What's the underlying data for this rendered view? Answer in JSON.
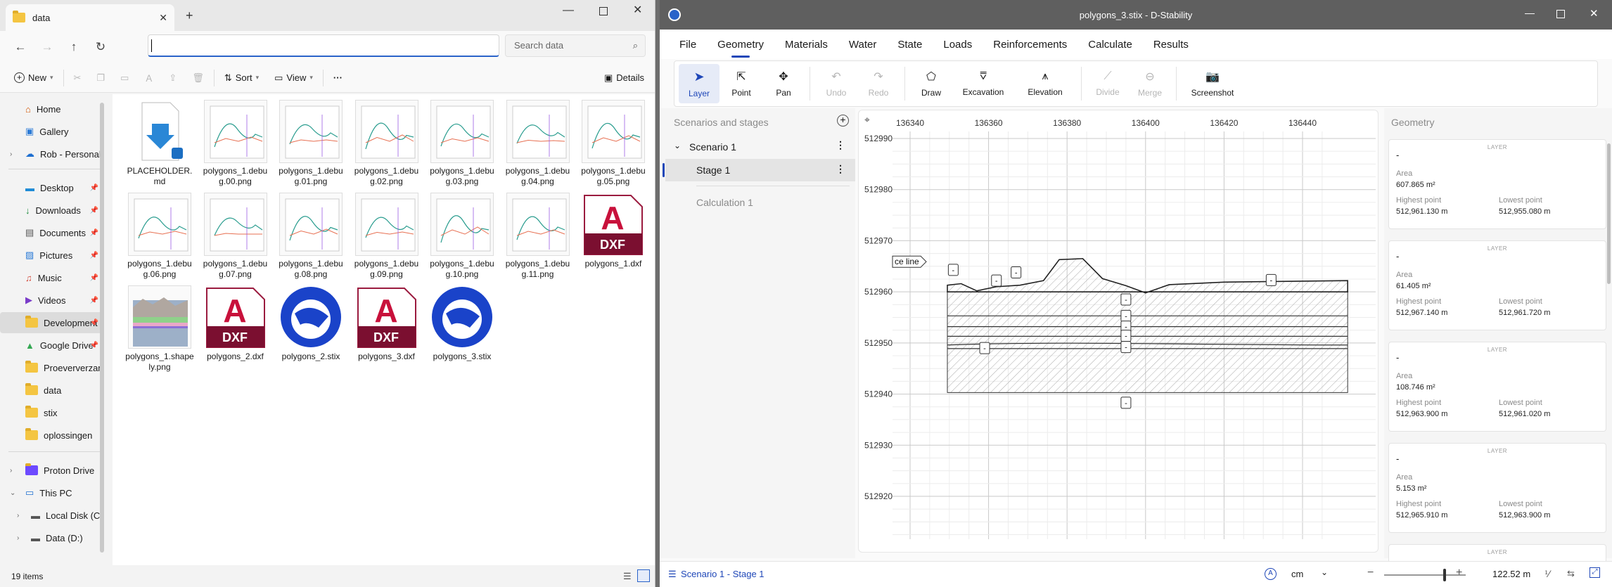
{
  "explorer": {
    "tab_title": "data",
    "search_placeholder": "Search data",
    "toolbar": {
      "new": "New",
      "sort": "Sort",
      "view": "View",
      "details": "Details"
    },
    "nav": [
      {
        "label": "Home"
      },
      {
        "label": "Gallery"
      },
      {
        "label": "Rob - Personal"
      },
      {
        "label": "Desktop"
      },
      {
        "label": "Downloads"
      },
      {
        "label": "Documents"
      },
      {
        "label": "Pictures"
      },
      {
        "label": "Music"
      },
      {
        "label": "Videos"
      },
      {
        "label": "Development"
      },
      {
        "label": "Google Drive"
      },
      {
        "label": "Proeververzameling"
      },
      {
        "label": "data"
      },
      {
        "label": "stix"
      },
      {
        "label": "oplossingen"
      },
      {
        "label": "Proton Drive"
      },
      {
        "label": "This PC"
      },
      {
        "label": "Local Disk (C:)"
      },
      {
        "label": "Data (D:)"
      }
    ],
    "files": [
      {
        "name": "PLACEHOLDER.md",
        "kind": "md"
      },
      {
        "name": "polygons_1.debug.00.png",
        "kind": "png"
      },
      {
        "name": "polygons_1.debug.01.png",
        "kind": "png"
      },
      {
        "name": "polygons_1.debug.02.png",
        "kind": "png"
      },
      {
        "name": "polygons_1.debug.03.png",
        "kind": "png"
      },
      {
        "name": "polygons_1.debug.04.png",
        "kind": "png"
      },
      {
        "name": "polygons_1.debug.05.png",
        "kind": "png"
      },
      {
        "name": "polygons_1.debug.06.png",
        "kind": "png"
      },
      {
        "name": "polygons_1.debug.07.png",
        "kind": "png"
      },
      {
        "name": "polygons_1.debug.08.png",
        "kind": "png"
      },
      {
        "name": "polygons_1.debug.09.png",
        "kind": "png"
      },
      {
        "name": "polygons_1.debug.10.png",
        "kind": "png"
      },
      {
        "name": "polygons_1.debug.11.png",
        "kind": "png"
      },
      {
        "name": "polygons_1.dxf",
        "kind": "dxf"
      },
      {
        "name": "polygons_1.shapely.png",
        "kind": "shapely"
      },
      {
        "name": "polygons_2.dxf",
        "kind": "dxf"
      },
      {
        "name": "polygons_2.stix",
        "kind": "stix"
      },
      {
        "name": "polygons_3.dxf",
        "kind": "dxf"
      },
      {
        "name": "polygons_3.stix",
        "kind": "stix"
      }
    ],
    "dxf_badge": "DXF",
    "status": "19 items"
  },
  "dstab": {
    "title": "polygons_3.stix - D-Stability",
    "menu": [
      "File",
      "Geometry",
      "Materials",
      "Water",
      "State",
      "Loads",
      "Reinforcements",
      "Calculate",
      "Results"
    ],
    "ribbon": [
      "Layer",
      "Point",
      "Pan",
      "Undo",
      "Redo",
      "Draw",
      "Excavation",
      "Elevation",
      "Divide",
      "Merge",
      "Screenshot"
    ],
    "left": {
      "header": "Scenarios and stages",
      "scenario": "Scenario 1",
      "stage": "Stage 1",
      "calc": "Calculation 1"
    },
    "canvas": {
      "x_ticks": [
        "136340",
        "136360",
        "136380",
        "136400",
        "136420",
        "136440"
      ],
      "y_ticks": [
        "512990",
        "512980",
        "512970",
        "512960",
        "512950",
        "512940",
        "512930",
        "512920"
      ],
      "ref_label": "ce line"
    },
    "right": {
      "header": "Geometry",
      "layer_caption": "LAYER",
      "area_label": "Area",
      "highest_label": "Highest point",
      "lowest_label": "Lowest point",
      "cards": [
        {
          "name": "-",
          "area": "607.865 m²",
          "highest": "512,961.130 m",
          "lowest": "512,955.080 m"
        },
        {
          "name": "-",
          "area": "61.405 m²",
          "highest": "512,967.140 m",
          "lowest": "512,961.720 m"
        },
        {
          "name": "-",
          "area": "108.746 m²",
          "highest": "512,963.900 m",
          "lowest": "512,961.020 m"
        },
        {
          "name": "-",
          "area": "5.153 m²",
          "highest": "512,965.910 m",
          "lowest": "512,963.900 m"
        }
      ]
    },
    "status": {
      "breadcrumb": "Scenario 1 - Stage 1",
      "unit": "cm",
      "zoom": "122.52 m"
    }
  }
}
